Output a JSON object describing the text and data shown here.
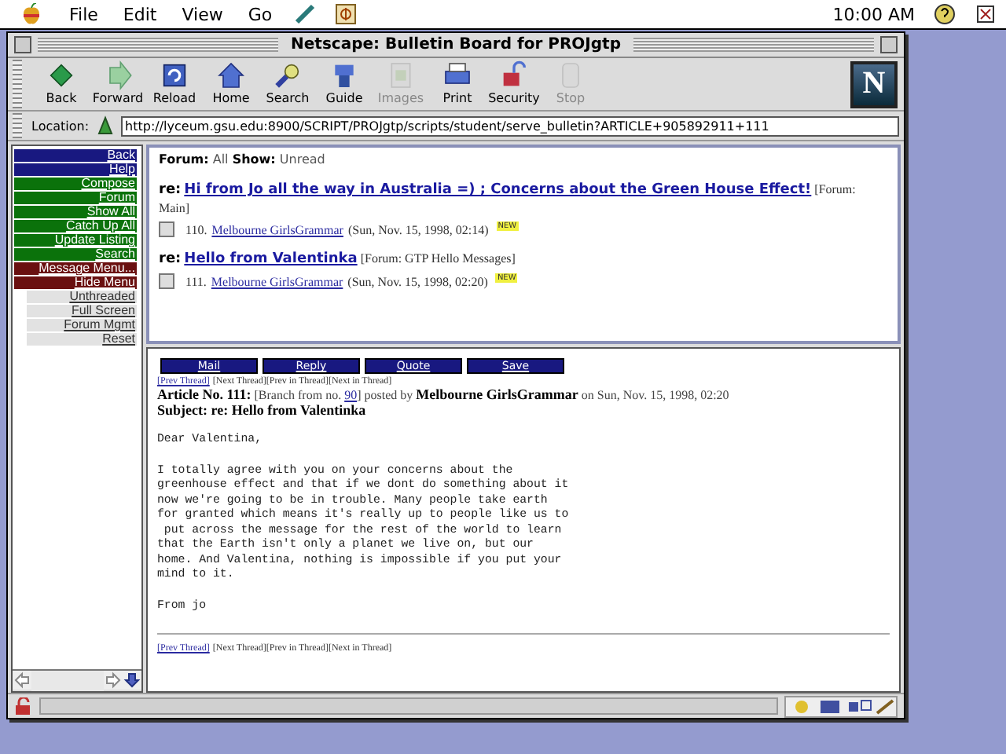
{
  "menu_bar": {
    "items": [
      "File",
      "Edit",
      "View",
      "Go"
    ],
    "clock": "10:00 AM"
  },
  "window": {
    "title": "Netscape: Bulletin Board for PROJgtp",
    "logo": "N"
  },
  "toolbar": [
    {
      "label": "Back",
      "disabled": false
    },
    {
      "label": "Forward",
      "disabled": false
    },
    {
      "label": "Reload",
      "disabled": false
    },
    {
      "label": "Home",
      "disabled": false
    },
    {
      "label": "Search",
      "disabled": false
    },
    {
      "label": "Guide",
      "disabled": false
    },
    {
      "label": "Images",
      "disabled": true
    },
    {
      "label": "Print",
      "disabled": false
    },
    {
      "label": "Security",
      "disabled": false
    },
    {
      "label": "Stop",
      "disabled": true
    }
  ],
  "location": {
    "label": "Location:",
    "url": "http://lyceum.gsu.edu:8900/SCRIPT/PROJgtp/scripts/student/serve_bulletin?ARTICLE+905892911+111"
  },
  "sidebar": {
    "items": [
      {
        "label": "Back",
        "kind": "nav"
      },
      {
        "label": "Help",
        "kind": "nav"
      },
      {
        "label": "Compose",
        "kind": "action"
      },
      {
        "label": "Forum",
        "kind": "action"
      },
      {
        "label": "Show All",
        "kind": "action"
      },
      {
        "label": "Catch Up All",
        "kind": "action"
      },
      {
        "label": "Update Listing",
        "kind": "action"
      },
      {
        "label": "Search",
        "kind": "action"
      },
      {
        "label": "Message Menu...",
        "kind": "menu"
      },
      {
        "label": "Hide Menu",
        "kind": "menu"
      },
      {
        "label": "Unthreaded",
        "kind": "option"
      },
      {
        "label": "Full Screen",
        "kind": "option"
      },
      {
        "label": "Forum Mgmt",
        "kind": "option"
      },
      {
        "label": "Reset",
        "kind": "option"
      }
    ]
  },
  "listing": {
    "filter": "**Forum:** All  **Show:** Unread",
    "posts": [
      {
        "prefix": "re:",
        "title": "Hi from Jo all the way in Australia =) ; Concerns about the Green House Effect!",
        "forum": "[Forum: Main]",
        "checked": false,
        "number": "110.",
        "author": "Melbourne GirlsGrammar",
        "date": "(Sun, Nov. 15, 1998, 02:14)",
        "badge": "NEW"
      },
      {
        "prefix": "re:",
        "title": "Hello from Valentinka",
        "forum": "[Forum: GTP Hello Messages]",
        "checked": false,
        "number": "111.",
        "author": "Melbourne GirlsGrammar",
        "date": "(Sun, Nov. 15, 1998, 02:20)",
        "badge": "NEW"
      }
    ]
  },
  "message": {
    "buttons": [
      "Mail",
      "Reply",
      "Quote",
      "Save"
    ],
    "thread_nav_top": {
      "link": "[Prev Thread]",
      "rest": "[Next Thread][Prev in Thread][Next in Thread]"
    },
    "article": {
      "before": "**Article No. 111:** [Branch from no.",
      "link": "90",
      "after": "] posted by **Melbourne GirlsGrammar** on Sun, Nov. 15, 1998, 02:20"
    },
    "subject": "Subject: re: Hello from Valentinka",
    "body": [
      "Dear Valentina,",
      "I totally agree with you on your concerns about the\ngreenhouse effect and that if we dont do something about it\nnow we're going to be in trouble. Many people take earth\nfor granted which means it's really up to people like us to\n put across the message for the rest of the world to learn\nthat the Earth isn't only a planet we live on, but our\nhome. And Valentina, nothing is impossible if you put your\nmind to it.",
      "From jo"
    ],
    "thread_nav_bottom": {
      "link": "[Prev Thread]",
      "rest": "[Next Thread][Prev in Thread][Next in Thread]"
    }
  }
}
